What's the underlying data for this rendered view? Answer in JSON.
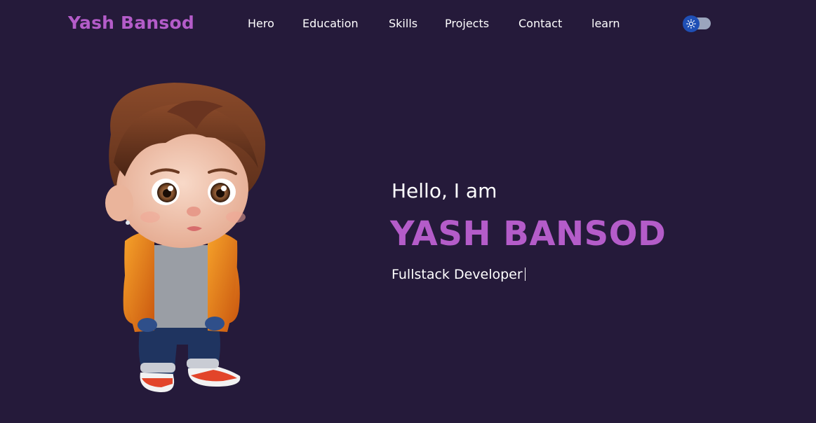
{
  "header": {
    "brand": "Yash Bansod",
    "nav": [
      "Hero",
      "Education",
      "Skills",
      "Projects",
      "Contact",
      "learn"
    ],
    "theme_toggle": {
      "icon": "sun-icon",
      "state": "off"
    }
  },
  "hero": {
    "greeting": "Hello, I am",
    "name": "YASH BANSOD",
    "role": "Fullstack Developer",
    "avatar_icon": "cartoon-boy-avatar"
  },
  "colors": {
    "background": "#251a3a",
    "accent": "#b45cc9",
    "text": "#ffffff",
    "toggle_track": "#9ba5bd",
    "toggle_knob": "#1f4fb5"
  }
}
